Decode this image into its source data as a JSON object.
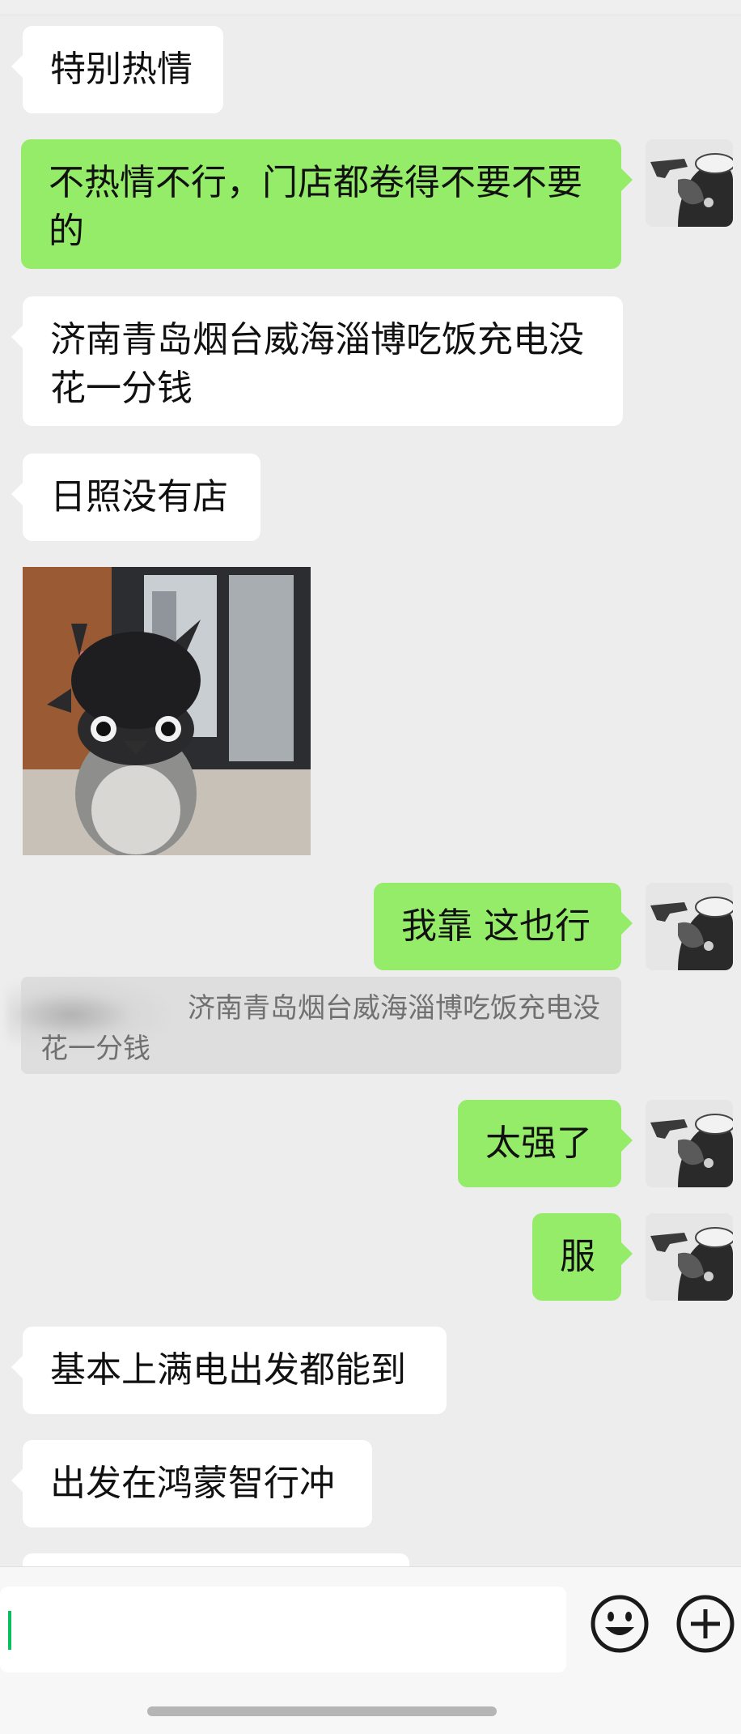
{
  "messages": [
    {
      "side": "in",
      "text": "特别热情"
    },
    {
      "side": "out",
      "text": "不热情不行，门店都卷得不要不要的"
    },
    {
      "side": "in",
      "text": "济南青岛烟台威海淄博吃饭充电没花一分钱"
    },
    {
      "side": "in",
      "text": "日照没有店"
    },
    {
      "side": "in",
      "type": "image",
      "description_icon": "penguin-photo"
    },
    {
      "side": "out",
      "text": "我靠 这也行"
    },
    {
      "side": "out",
      "text": "太强了"
    },
    {
      "side": "out",
      "text": "服"
    },
    {
      "side": "in",
      "text": "基本上满电出发都能到"
    },
    {
      "side": "in",
      "text": "出发在鸿蒙智行冲"
    }
  ],
  "quote": {
    "text": "济南青岛烟台威海淄博吃饭充电没花一分钱"
  },
  "input": {
    "value": ""
  },
  "icons": {
    "emoji": "emoji-icon",
    "plus": "plus-icon"
  },
  "colors": {
    "out_bubble": "#95ec69",
    "in_bubble": "#ffffff",
    "background": "#ededed",
    "caret": "#07c160"
  }
}
